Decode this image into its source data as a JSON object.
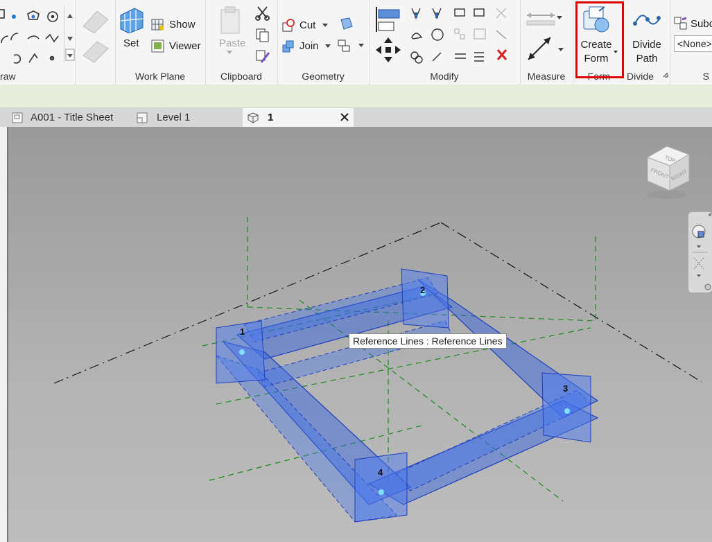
{
  "ribbon": {
    "draw": {
      "label": "raw"
    },
    "work_plane": {
      "label": "Work Plane",
      "set": "Set",
      "show": "Show",
      "viewer": "Viewer"
    },
    "clipboard": {
      "label": "Clipboard",
      "paste": "Paste"
    },
    "geometry": {
      "label": "Geometry",
      "cut": "Cut",
      "join": "Join"
    },
    "modify": {
      "label": "Modify"
    },
    "measure": {
      "label": "Measure"
    },
    "form": {
      "label": "Form",
      "create_form_line1": "Create",
      "create_form_line2": "Form"
    },
    "divide": {
      "label": "Divide",
      "divide_path_line1": "Divide",
      "divide_path_line2": "Path"
    },
    "subcategory": {
      "label_partial": "Subc",
      "value": "<None>"
    }
  },
  "tabs": [
    {
      "label": "A001 - Title Sheet"
    },
    {
      "label": "Level 1"
    },
    {
      "label": "1"
    }
  ],
  "viewport": {
    "tooltip": "Reference Lines : Reference Lines",
    "viewcube": {
      "top": "TOP",
      "front": "FRONT",
      "right": "RIGHT"
    },
    "point_labels": [
      "1",
      "2",
      "3",
      "4"
    ]
  },
  "colors": {
    "highlight_red": "#e00000",
    "form_blue": "#2f5fe0",
    "ref_green": "#1a8a1a"
  }
}
